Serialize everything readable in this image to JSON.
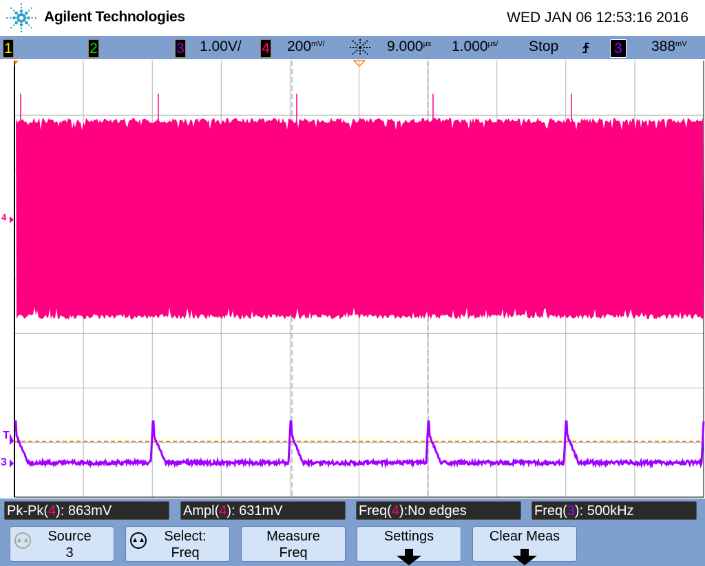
{
  "header": {
    "brand": "Agilent Technologies",
    "datetime": "WED JAN 06 12:53:16 2016"
  },
  "status_bar": {
    "ch1": "1",
    "ch2": "2",
    "ch3": "3",
    "ch3_scale": "1.00V/",
    "ch4": "4",
    "ch4_scale_num": "200",
    "ch4_scale_unit": "mV/",
    "time_delay": "9.000",
    "time_delay_unit": "µs",
    "time_scale": "1.000",
    "time_scale_unit": "µs/",
    "run_state": "Stop",
    "trigger_slope": "rising",
    "trigger_source": "3",
    "trigger_level": "388",
    "trigger_level_unit": "mV"
  },
  "colors": {
    "ch1": "#f0f000",
    "ch2": "#00e000",
    "ch3": "#a000ff",
    "ch4": "#ff0080",
    "trigger": "#ff8000",
    "panel": "#7f9fcf"
  },
  "markers": {
    "ch4": "4",
    "ch3": "3",
    "trigger": "T"
  },
  "measurements": [
    {
      "label": "Pk-Pk(",
      "ch": "4",
      "value": "): 863mV"
    },
    {
      "label": "Ampl(",
      "ch": "4",
      "value": "): 631mV"
    },
    {
      "label": "Freq(",
      "ch": "4",
      "value": "):No edges"
    },
    {
      "label": "Freq(",
      "ch": "3",
      "value": "): 500kHz"
    }
  ],
  "softkeys": [
    {
      "line1": "Source",
      "line2": "3",
      "icon": "rotary-knob-icon"
    },
    {
      "line1": "Select:",
      "line2": "Freq",
      "icon": "rotary-knob-icon"
    },
    {
      "line1": "Measure",
      "line2": "Freq"
    },
    {
      "line1": "Settings",
      "line2": "",
      "icon": "down-arrow-icon"
    },
    {
      "line1": "Clear Meas",
      "line2": "",
      "icon": "down-arrow-icon"
    }
  ]
}
